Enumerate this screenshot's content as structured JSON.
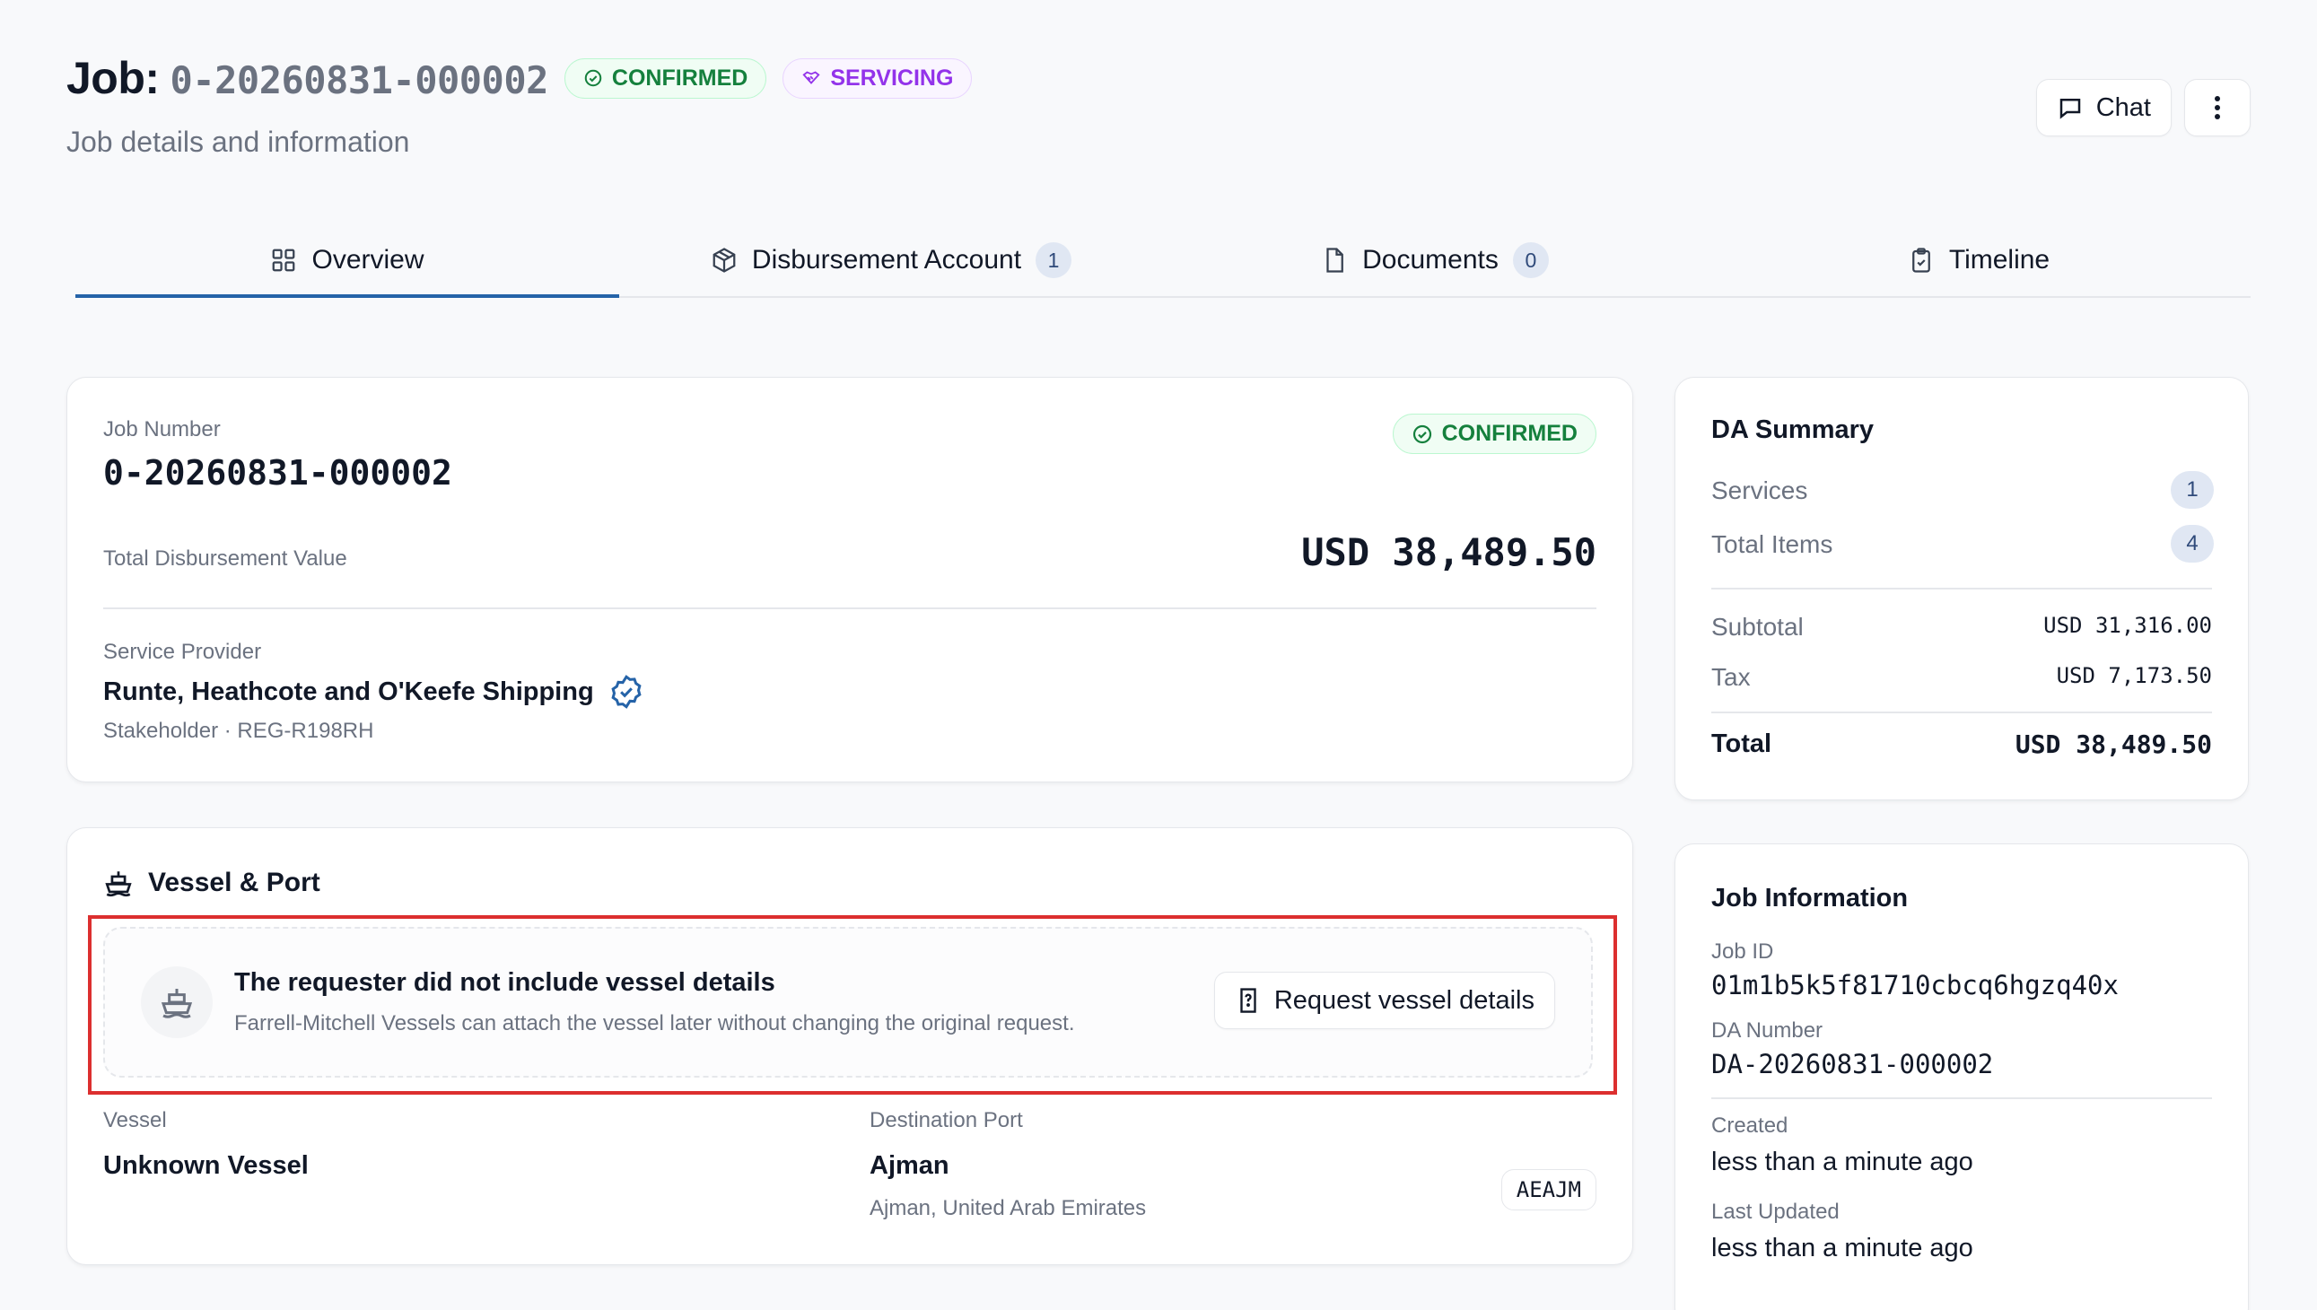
{
  "header": {
    "title_prefix": "Job:",
    "job_id": "0-20260831-000002",
    "status_badge": "CONFIRMED",
    "stage_badge": "SERVICING",
    "subtitle": "Job details and information",
    "chat_label": "Chat"
  },
  "tabs": [
    {
      "label": "Overview",
      "icon": "grid-icon",
      "active": true
    },
    {
      "label": "Disbursement Account",
      "icon": "package-icon",
      "count": "1"
    },
    {
      "label": "Documents",
      "icon": "file-icon",
      "count": "0"
    },
    {
      "label": "Timeline",
      "icon": "clipboard-icon"
    }
  ],
  "job_card": {
    "job_number_label": "Job Number",
    "job_number": "0-20260831-000002",
    "status": "CONFIRMED",
    "total_label": "Total Disbursement Value",
    "total_value": "USD 38,489.50",
    "provider_label": "Service Provider",
    "provider_name": "Runte, Heathcote and O'Keefe Shipping",
    "provider_meta": "Stakeholder · REG-R198RH"
  },
  "vessel_card": {
    "title": "Vessel & Port",
    "notice_title": "The requester did not include vessel details",
    "notice_body": "Farrell-Mitchell Vessels can attach the vessel later without changing the original request.",
    "request_button": "Request vessel details",
    "vessel_label": "Vessel",
    "vessel_value": "Unknown Vessel",
    "port_label": "Destination Port",
    "port_value": "Ajman",
    "port_location": "Ajman, United Arab Emirates",
    "port_code": "AEAJM"
  },
  "da_summary": {
    "title": "DA Summary",
    "services_label": "Services",
    "services_count": "1",
    "items_label": "Total Items",
    "items_count": "4",
    "subtotal_label": "Subtotal",
    "subtotal_value": "USD 31,316.00",
    "tax_label": "Tax",
    "tax_value": "USD 7,173.50",
    "total_label": "Total",
    "total_value": "USD 38,489.50"
  },
  "job_info": {
    "title": "Job Information",
    "job_id_label": "Job ID",
    "job_id_value": "01m1b5k5f81710cbcq6hgzq40x",
    "da_number_label": "DA Number",
    "da_number_value": "DA-20260831-000002",
    "created_label": "Created",
    "created_value": "less than a minute ago",
    "updated_label": "Last Updated",
    "updated_value": "less than a minute ago"
  },
  "colors": {
    "accent": "#2563a8",
    "confirmed": "#15803d",
    "servicing": "#9333ea",
    "highlight": "#dc2f2f"
  }
}
